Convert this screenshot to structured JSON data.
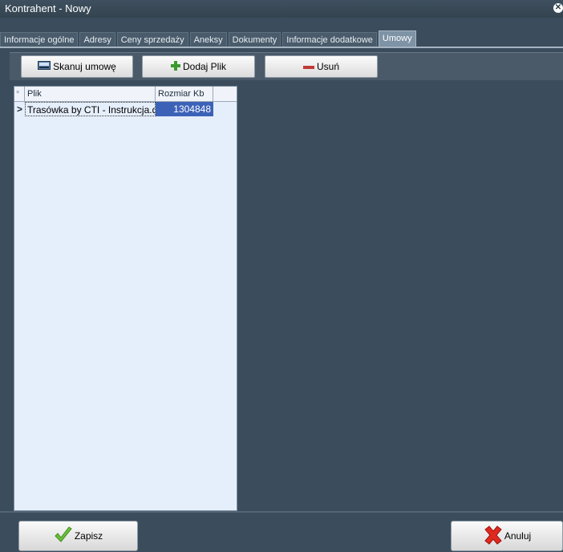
{
  "window": {
    "title": "Kontrahent - Nowy",
    "close_glyph": "✕"
  },
  "tabs": [
    {
      "label": "Informacje ogólne"
    },
    {
      "label": "Adresy"
    },
    {
      "label": "Ceny sprzedaży"
    },
    {
      "label": "Aneksy"
    },
    {
      "label": "Dokumenty"
    },
    {
      "label": "Informacje dodatkowe"
    },
    {
      "label": "Umowy",
      "active": true
    }
  ],
  "toolbar": {
    "scan_label": "Skanuj umowę",
    "add_label": "Dodaj Plik",
    "delete_label": "Usuń"
  },
  "grid": {
    "columns": [
      "Plik",
      "Rozmiar Kb"
    ],
    "new_row_glyph": "*",
    "current_row_glyph": ">",
    "rows": [
      {
        "file": "Trasówka by CTI - Instrukcja.dc",
        "size": "1304848"
      }
    ]
  },
  "footer": {
    "save_label": "Zapisz",
    "cancel_label": "Anuluj"
  },
  "colors": {
    "background": "#3b4d5d",
    "grid_background": "#e5eefb",
    "selection": "#3c62b8"
  }
}
